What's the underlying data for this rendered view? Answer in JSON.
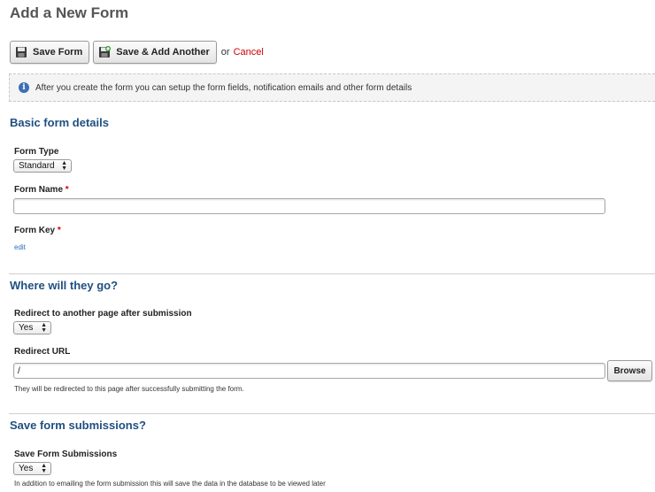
{
  "page": {
    "title": "Add a New Form"
  },
  "toolbar": {
    "save_label": "Save Form",
    "save_add_label": "Save & Add Another",
    "or_text": "or",
    "cancel_label": "Cancel"
  },
  "info": {
    "text": "After you create the form you can setup the form fields, notification emails and other form details"
  },
  "basic": {
    "title": "Basic form details",
    "form_type": {
      "label": "Form Type",
      "value": "Standard"
    },
    "form_name": {
      "label": "Form Name",
      "required_mark": "*",
      "value": ""
    },
    "form_key": {
      "label": "Form Key",
      "required_mark": "*",
      "edit_label": "edit"
    }
  },
  "redirect": {
    "title": "Where will they go?",
    "redirect_toggle": {
      "label": "Redirect to another page after submission",
      "value": "Yes"
    },
    "redirect_url": {
      "label": "Redirect URL",
      "value": "/",
      "browse_label": "Browse",
      "help": "They will be redirected to this page after successfully submitting the form."
    }
  },
  "submissions": {
    "title": "Save form submissions?",
    "save_toggle": {
      "label": "Save Form Submissions",
      "value": "Yes",
      "help": "In addition to emailing the form submission this will save the data in the database to be viewed later"
    }
  },
  "colors": {
    "section_title": "#1f4f82",
    "required": "#cc0000",
    "link": "#2a6bc2",
    "info_icon": "#3b6fb6"
  }
}
